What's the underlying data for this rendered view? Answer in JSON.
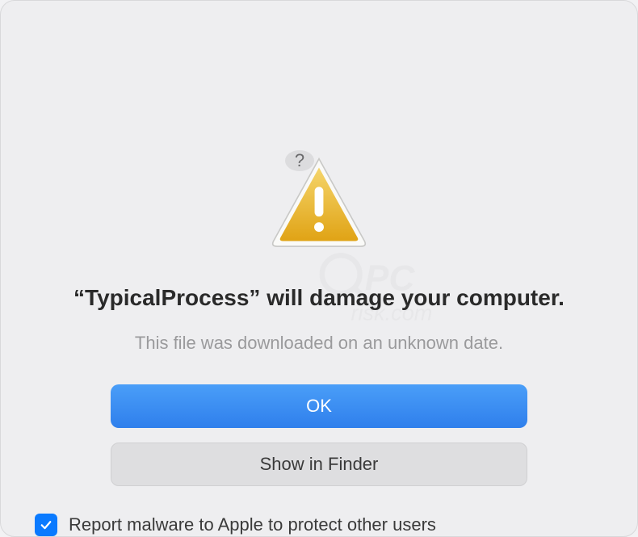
{
  "dialog": {
    "title": "“TypicalProcess” will damage your computer.",
    "subtitle": "This file was downloaded on an unknown date.",
    "primary_button": "OK",
    "secondary_button": "Show in Finder",
    "checkbox_label": "Report malware to Apple to protect other users",
    "checkbox_checked": true,
    "help_label": "?"
  },
  "icons": {
    "warning": "warning-triangle",
    "help": "question-circle",
    "check": "checkmark"
  },
  "colors": {
    "primary_button": "#2f7fec",
    "checkbox": "#0a7aff",
    "warning_fill": "#e8ae27"
  }
}
